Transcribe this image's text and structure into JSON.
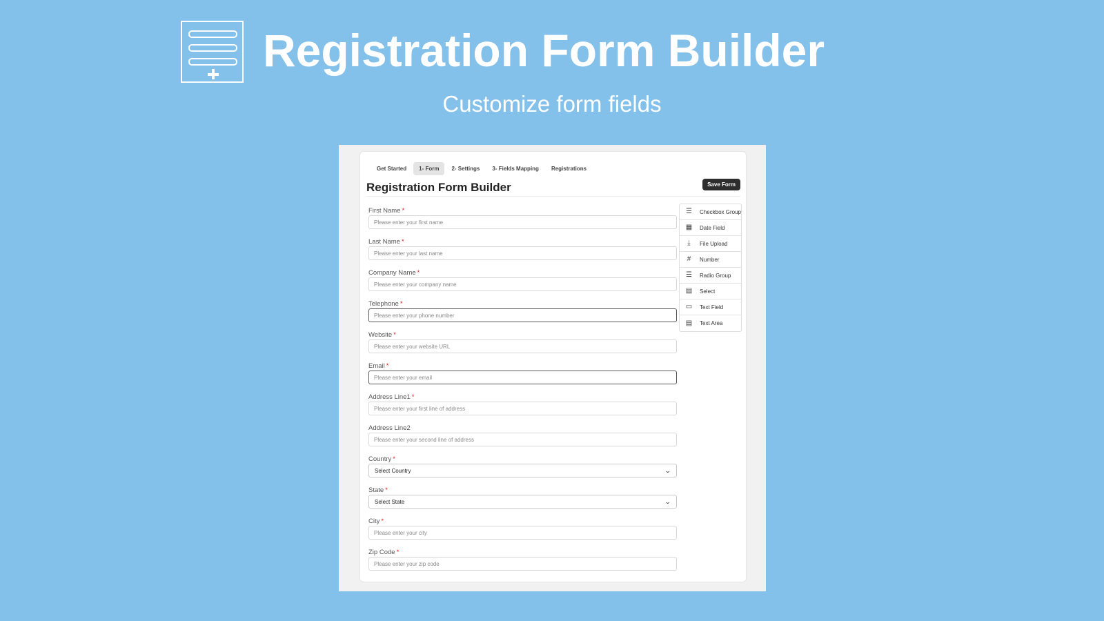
{
  "hero": {
    "title": "Registration Form Builder",
    "subtitle": "Customize form fields"
  },
  "app": {
    "tabs": [
      {
        "label": "Get Started"
      },
      {
        "label": "1- Form"
      },
      {
        "label": "2- Settings"
      },
      {
        "label": "3- Fields Mapping"
      },
      {
        "label": "Registrations"
      }
    ],
    "active_tab": "1- Form",
    "page_title": "Registration Form Builder",
    "save_label": "Save Form"
  },
  "fields": [
    {
      "label": "First Name",
      "required": "*",
      "placeholder": "Please enter your first name"
    },
    {
      "label": "Last Name",
      "required": "*",
      "placeholder": "Please enter your last name"
    },
    {
      "label": "Company Name",
      "required": "*",
      "placeholder": "Please enter your company name"
    },
    {
      "label": "Telephone",
      "required": "*",
      "placeholder": "Please enter your phone number"
    },
    {
      "label": "Website",
      "required": "*",
      "placeholder": "Please enter your website URL"
    },
    {
      "label": "Email",
      "required": "*",
      "placeholder": "Please enter your email"
    },
    {
      "label": "Address Line1",
      "required": "*",
      "placeholder": "Please enter your first line of address"
    },
    {
      "label": "Address Line2",
      "required": "",
      "placeholder": "Please enter your second line of address"
    },
    {
      "label": "Country",
      "required": "*",
      "value": "Select Country"
    },
    {
      "label": "State",
      "required": "*",
      "value": "Select State"
    },
    {
      "label": "City",
      "required": "*",
      "placeholder": "Please enter your city"
    },
    {
      "label": "Zip Code",
      "required": "*",
      "placeholder": "Please enter your zip code"
    }
  ],
  "palette": [
    {
      "label": "Checkbox Group",
      "icon": "checklist-icon"
    },
    {
      "label": "Date Field",
      "icon": "calendar-icon"
    },
    {
      "label": "File Upload",
      "icon": "upload-icon"
    },
    {
      "label": "Number",
      "icon": "hash-icon"
    },
    {
      "label": "Radio Group",
      "icon": "list-icon"
    },
    {
      "label": "Select",
      "icon": "select-box-icon"
    },
    {
      "label": "Text Field",
      "icon": "text-field-icon"
    },
    {
      "label": "Text Area",
      "icon": "text-area-icon"
    }
  ],
  "colors": {
    "background": "#83c0ea",
    "required": "#dd2222",
    "save_button": "#2d2d2d"
  }
}
